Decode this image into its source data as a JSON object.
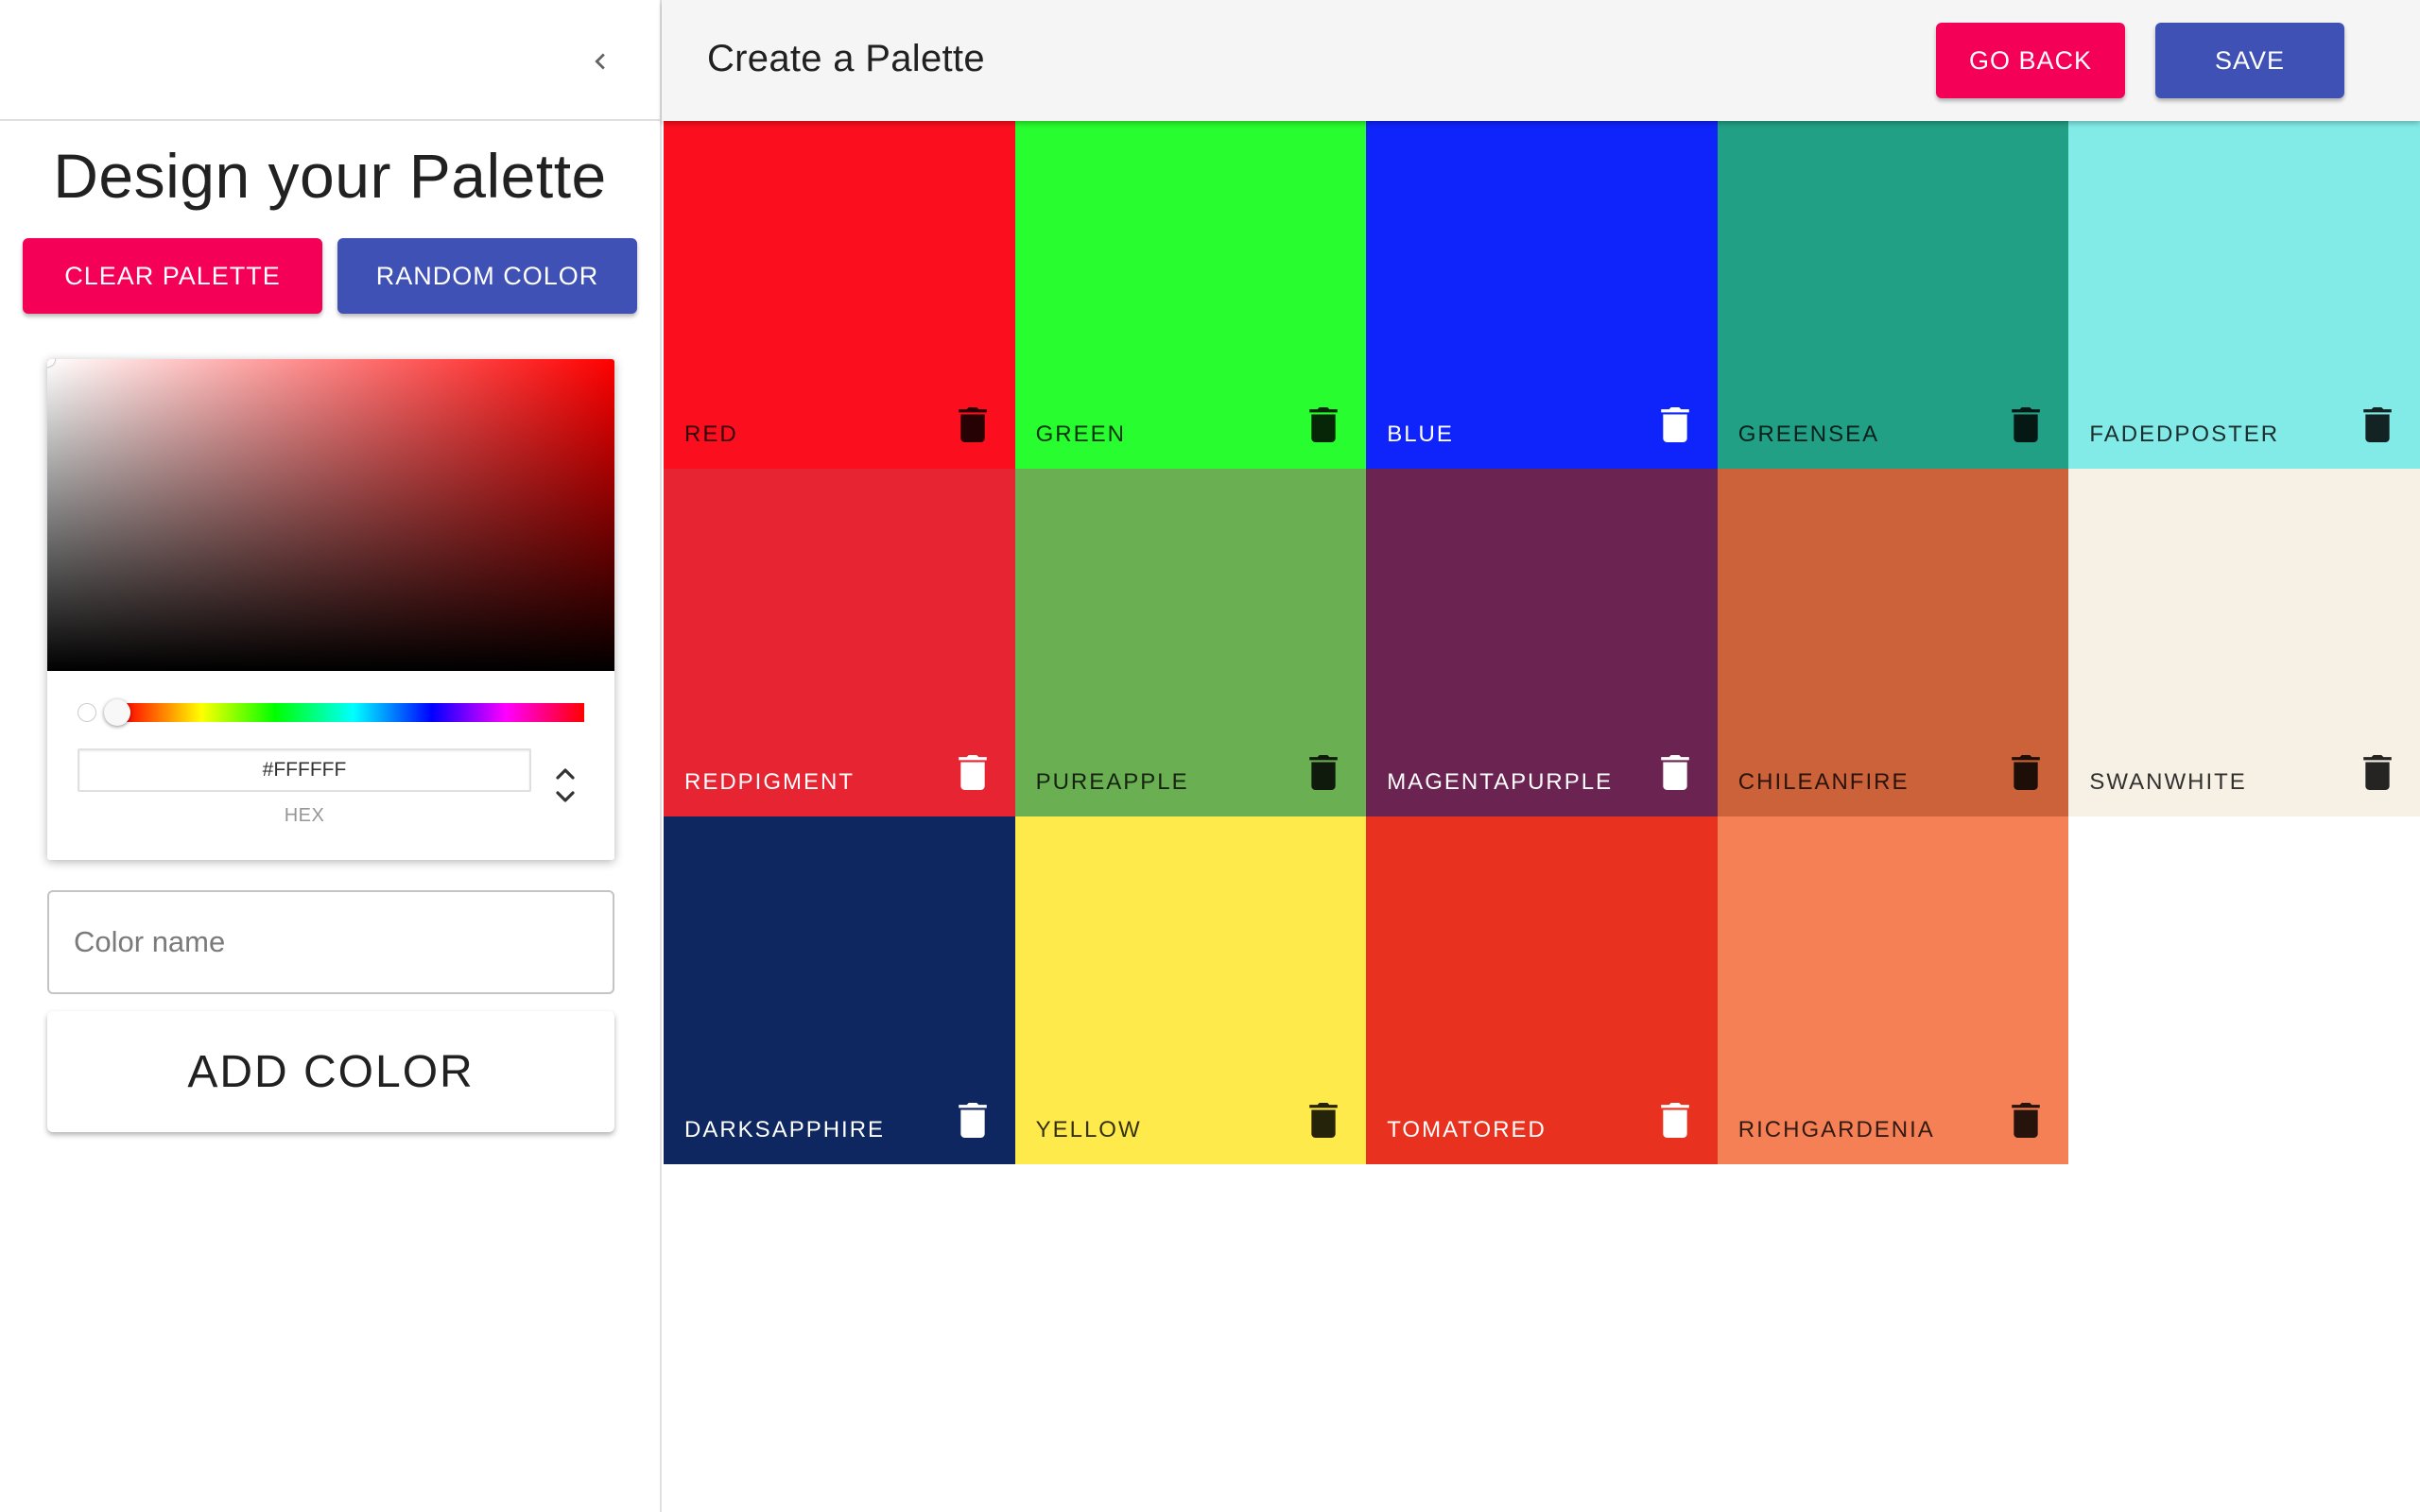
{
  "sidebar": {
    "title": "Design your Palette",
    "clear_label": "Clear Palette",
    "random_label": "Random Color",
    "picker": {
      "hex_value": "#FFFFFF",
      "hex_label": "HEX",
      "hue_color": "#ff0000"
    },
    "name_placeholder": "Color name",
    "add_label": "Add Color"
  },
  "topbar": {
    "title": "Create a Palette",
    "go_back_label": "Go Back",
    "save_label": "Save"
  },
  "colors": [
    {
      "name": "red",
      "hex": "#fb0f1e",
      "text": "dark"
    },
    {
      "name": "green",
      "hex": "#28fd2f",
      "text": "dark"
    },
    {
      "name": "blue",
      "hex": "#0f23fb",
      "text": "light"
    },
    {
      "name": "greensea",
      "hex": "#22a085",
      "text": "dark"
    },
    {
      "name": "fadedposter",
      "hex": "#83ebe7",
      "text": "dark"
    },
    {
      "name": "redpigment",
      "hex": "#e62432",
      "text": "light"
    },
    {
      "name": "pureapple",
      "hex": "#6aaf51",
      "text": "dark"
    },
    {
      "name": "magentapurple",
      "hex": "#6b2351",
      "text": "light"
    },
    {
      "name": "chileanfire",
      "hex": "#cb623a",
      "text": "dark"
    },
    {
      "name": "swanwhite",
      "hex": "#f7f0e5",
      "text": "dark"
    },
    {
      "name": "darksapphire",
      "hex": "#0e2760",
      "text": "light"
    },
    {
      "name": "yellow",
      "hex": "#ffea4c",
      "text": "dark"
    },
    {
      "name": "tomatored",
      "hex": "#e8321f",
      "text": "light"
    },
    {
      "name": "richgardenia",
      "hex": "#f58055",
      "text": "dark"
    }
  ],
  "icons": {
    "collapse": "chevron-left-icon",
    "delete": "trash-icon",
    "toggle": "unfold-arrows-icon"
  }
}
